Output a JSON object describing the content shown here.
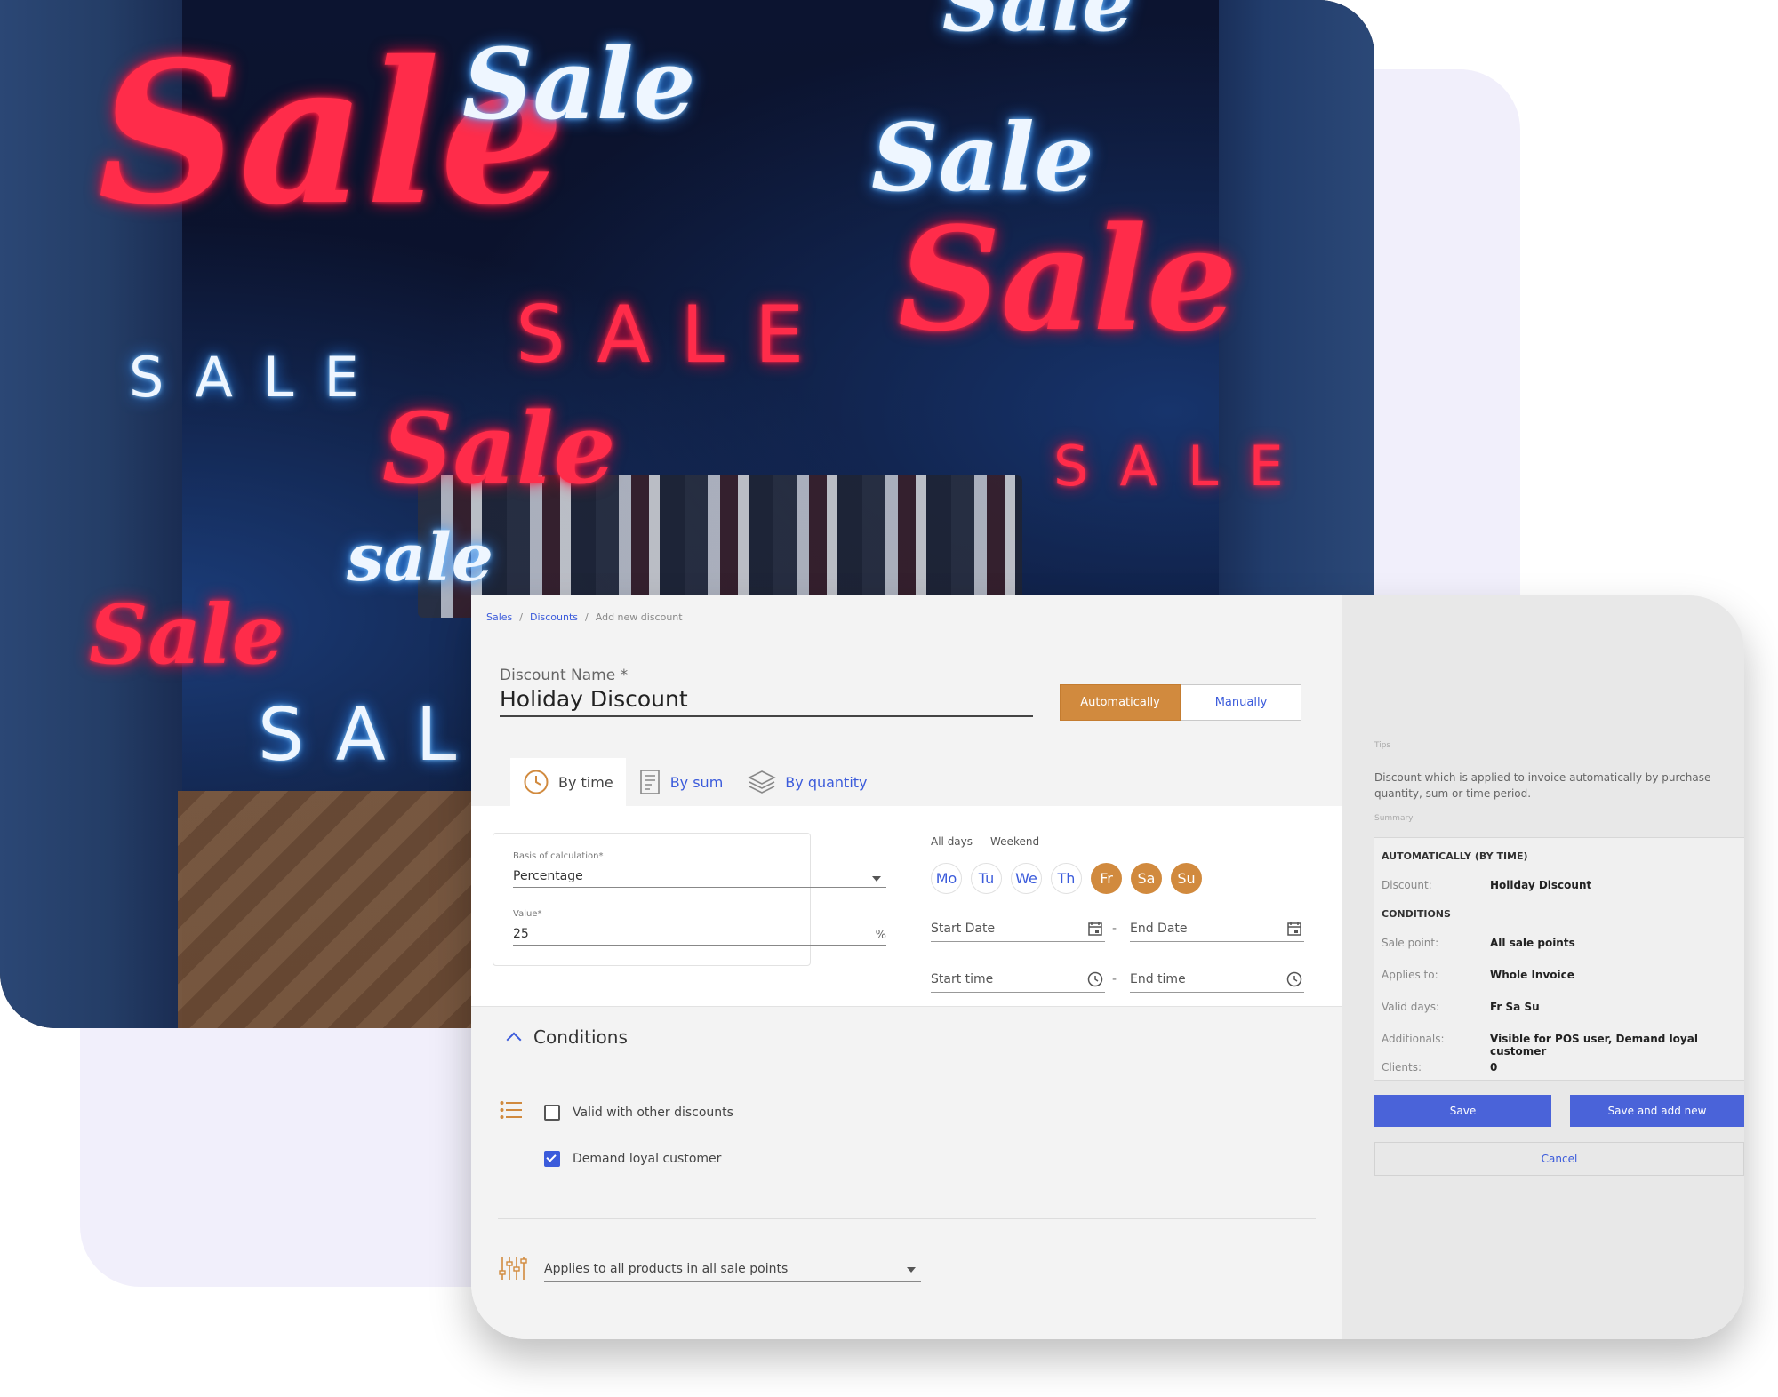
{
  "hero": {
    "signs": [
      "Sale",
      "Sale",
      "Sale",
      "SALE",
      "Sale",
      "SALE",
      "Sale",
      "SALE",
      "sale",
      "Sale",
      "SAL",
      "Sale"
    ]
  },
  "breadcrumb": {
    "items": [
      "Sales",
      "Discounts",
      "Add new discount"
    ]
  },
  "form": {
    "name_label": "Discount Name *",
    "name_value": "Holiday Discount",
    "mode": {
      "auto": "Automatically",
      "manual": "Manually",
      "selected": "Automatically"
    },
    "tabs": [
      {
        "label": "By time",
        "icon": "clock-icon",
        "active": true
      },
      {
        "label": "By sum",
        "icon": "receipt-icon",
        "active": false
      },
      {
        "label": "By quantity",
        "icon": "layers-icon",
        "active": false
      }
    ],
    "basis_label": "Basis of calculation*",
    "basis_value": "Percentage",
    "value_label": "Value*",
    "value_value": "25",
    "value_unit": "%",
    "day_presets": [
      "All days",
      "Weekend"
    ],
    "days": [
      {
        "label": "Mo",
        "selected": false
      },
      {
        "label": "Tu",
        "selected": false
      },
      {
        "label": "We",
        "selected": false
      },
      {
        "label": "Th",
        "selected": false
      },
      {
        "label": "Fr",
        "selected": true
      },
      {
        "label": "Sa",
        "selected": true
      },
      {
        "label": "Su",
        "selected": true
      }
    ],
    "start_date": "Start Date",
    "end_date": "End Date",
    "start_time": "Start time",
    "end_time": "End time",
    "range_sep": "-"
  },
  "conditions": {
    "title": "Conditions",
    "valid_with_others": {
      "label": "Valid with other discounts",
      "checked": false
    },
    "demand_loyal": {
      "label": "Demand loyal customer",
      "checked": true
    },
    "applies_value": "Applies to all products in all sale points"
  },
  "side": {
    "tips_label": "Tips",
    "tips_text": "Discount which is applied to invoice automatically by purchase quantity, sum or time period.",
    "summary_label": "Summary",
    "summary_title": "AUTOMATICALLY (BY TIME)",
    "discount_key": "Discount:",
    "discount_value": "Holiday Discount",
    "conditions_title": "CONDITIONS",
    "rows": [
      {
        "k": "Sale point:",
        "v": "All sale points"
      },
      {
        "k": "Applies to:",
        "v": "Whole Invoice"
      },
      {
        "k": "Valid days:",
        "v": "Fr Sa Su"
      },
      {
        "k": "Additionals:",
        "v": "Visible for POS user, Demand loyal customer"
      },
      {
        "k": "Clients:",
        "v": "0"
      }
    ],
    "save": "Save",
    "save_new": "Save and add new",
    "cancel": "Cancel"
  },
  "colors": {
    "accent": "#d18a3e",
    "primary": "#4a63d9",
    "link": "#3b5bdb"
  }
}
